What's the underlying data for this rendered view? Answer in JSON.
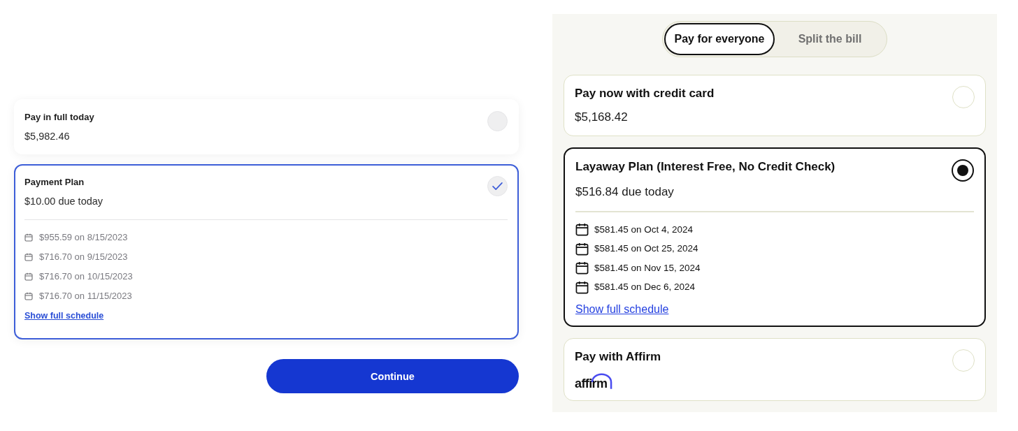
{
  "left_panel": {
    "options": [
      {
        "kind": "price",
        "title": "Pay in full today",
        "amount": "$5,982.46",
        "selected": false
      },
      {
        "kind": "plan",
        "title": "Payment Plan",
        "amount": "$10.00 due today",
        "selected": true,
        "schedule": [
          "$955.59 on 8/15/2023",
          "$716.70 on 9/15/2023",
          "$716.70 on 10/15/2023",
          "$716.70 on 11/15/2023"
        ],
        "schedule_link": "Show full schedule"
      }
    ],
    "continue_button": "Continue"
  },
  "right_panel": {
    "tabs": [
      {
        "label": "Pay for everyone",
        "selected": true
      },
      {
        "label": "Split the bill",
        "selected": false
      }
    ],
    "options": [
      {
        "kind": "price",
        "title": "Pay now with credit card",
        "amount": "$5,168.42",
        "selected": false
      },
      {
        "kind": "plan",
        "title": "Layaway Plan (Interest Free, No Credit Check)",
        "amount": "$516.84 due today",
        "selected": true,
        "schedule": [
          "$581.45 on Oct 4, 2024",
          "$581.45 on Oct 25, 2024",
          "$581.45 on Nov 15, 2024",
          "$581.45 on Dec 6, 2024"
        ],
        "schedule_link": "Show full schedule"
      },
      {
        "kind": "logo",
        "title": "Pay with Affirm",
        "logo": "affirm",
        "selected": false
      }
    ]
  }
}
